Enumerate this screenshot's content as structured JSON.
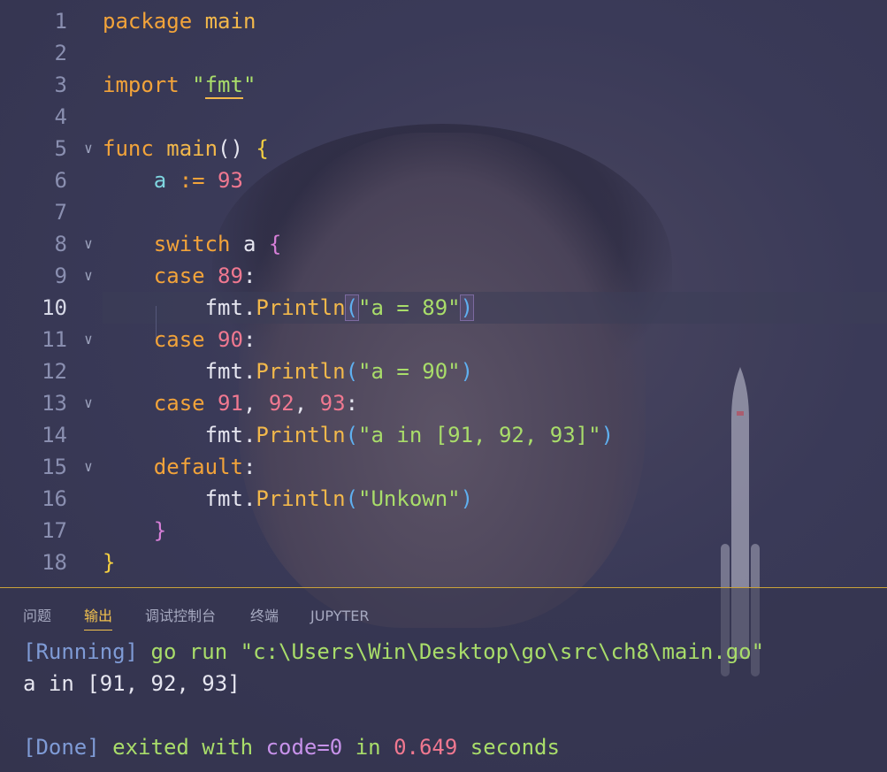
{
  "editor": {
    "active_line": "10",
    "lines": [
      {
        "n": "1",
        "tokens": [
          {
            "t": "package ",
            "c": "kw"
          },
          {
            "t": "main",
            "c": "fn"
          }
        ]
      },
      {
        "n": "2",
        "tokens": []
      },
      {
        "n": "3",
        "tokens": [
          {
            "t": "import ",
            "c": "kw"
          },
          {
            "t": "\"",
            "c": "str2"
          },
          {
            "t": "fmt",
            "c": "fmt"
          },
          {
            "t": "\"",
            "c": "str2"
          }
        ]
      },
      {
        "n": "4",
        "tokens": []
      },
      {
        "n": "5",
        "tokens": [
          {
            "t": "func ",
            "c": "kw"
          },
          {
            "t": "main",
            "c": "fn"
          },
          {
            "t": "() ",
            "c": "pun"
          },
          {
            "t": "{",
            "c": "br1"
          }
        ]
      },
      {
        "n": "6",
        "tokens": [
          {
            "t": "    "
          },
          {
            "t": "a",
            "c": "var"
          },
          {
            "t": " := ",
            "c": "kw"
          },
          {
            "t": "93",
            "c": "num"
          }
        ]
      },
      {
        "n": "7",
        "tokens": []
      },
      {
        "n": "8",
        "tokens": [
          {
            "t": "    "
          },
          {
            "t": "switch ",
            "c": "kw"
          },
          {
            "t": "a ",
            "c": "id"
          },
          {
            "t": "{",
            "c": "br2"
          }
        ]
      },
      {
        "n": "9",
        "tokens": [
          {
            "t": "    "
          },
          {
            "t": "case ",
            "c": "kw"
          },
          {
            "t": "89",
            "c": "num"
          },
          {
            "t": ":",
            "c": "pun"
          }
        ]
      },
      {
        "n": "10",
        "tokens": [
          {
            "t": "        "
          },
          {
            "t": "fmt",
            "c": "id"
          },
          {
            "t": ".",
            "c": "pun"
          },
          {
            "t": "Println",
            "c": "fn"
          },
          {
            "t": "(",
            "c": "br3hl"
          },
          {
            "t": "\"a = 89\"",
            "c": "str"
          },
          {
            "t": ")",
            "c": "br3hl"
          }
        ]
      },
      {
        "n": "11",
        "tokens": [
          {
            "t": "    "
          },
          {
            "t": "case ",
            "c": "kw"
          },
          {
            "t": "90",
            "c": "num"
          },
          {
            "t": ":",
            "c": "pun"
          }
        ]
      },
      {
        "n": "12",
        "tokens": [
          {
            "t": "        "
          },
          {
            "t": "fmt",
            "c": "id"
          },
          {
            "t": ".",
            "c": "pun"
          },
          {
            "t": "Println",
            "c": "fn"
          },
          {
            "t": "(",
            "c": "br3"
          },
          {
            "t": "\"a = 90\"",
            "c": "str"
          },
          {
            "t": ")",
            "c": "br3"
          }
        ]
      },
      {
        "n": "13",
        "tokens": [
          {
            "t": "    "
          },
          {
            "t": "case ",
            "c": "kw"
          },
          {
            "t": "91",
            "c": "num"
          },
          {
            "t": ", ",
            "c": "pun"
          },
          {
            "t": "92",
            "c": "num"
          },
          {
            "t": ", ",
            "c": "pun"
          },
          {
            "t": "93",
            "c": "num"
          },
          {
            "t": ":",
            "c": "pun"
          }
        ]
      },
      {
        "n": "14",
        "tokens": [
          {
            "t": "        "
          },
          {
            "t": "fmt",
            "c": "id"
          },
          {
            "t": ".",
            "c": "pun"
          },
          {
            "t": "Println",
            "c": "fn"
          },
          {
            "t": "(",
            "c": "br3"
          },
          {
            "t": "\"a in [91, 92, 93]\"",
            "c": "str"
          },
          {
            "t": ")",
            "c": "br3"
          }
        ]
      },
      {
        "n": "15",
        "tokens": [
          {
            "t": "    "
          },
          {
            "t": "default",
            "c": "kw"
          },
          {
            "t": ":",
            "c": "pun"
          }
        ]
      },
      {
        "n": "16",
        "tokens": [
          {
            "t": "        "
          },
          {
            "t": "fmt",
            "c": "id"
          },
          {
            "t": ".",
            "c": "pun"
          },
          {
            "t": "Println",
            "c": "fn"
          },
          {
            "t": "(",
            "c": "br3"
          },
          {
            "t": "\"Unkown\"",
            "c": "str"
          },
          {
            "t": ")",
            "c": "br3"
          }
        ]
      },
      {
        "n": "17",
        "tokens": [
          {
            "t": "    "
          },
          {
            "t": "}",
            "c": "br2"
          }
        ]
      },
      {
        "n": "18",
        "tokens": [
          {
            "t": "}",
            "c": "br1"
          }
        ]
      }
    ],
    "foldable_lines": [
      "5",
      "8",
      "9",
      "11",
      "13",
      "15"
    ]
  },
  "panel": {
    "tabs": [
      {
        "label": "问题",
        "active": false
      },
      {
        "label": "输出",
        "active": true
      },
      {
        "label": "调试控制台",
        "active": false
      },
      {
        "label": "终端",
        "active": false
      },
      {
        "label": "JUPYTER",
        "active": false
      }
    ],
    "output": {
      "running_tag": "[Running]",
      "running_cmd": "go run \"c:\\Users\\Win\\Desktop\\go\\src\\ch8\\main.go\"",
      "result": "a in [91, 92, 93]",
      "done_tag": "[Done]",
      "done_text1": "exited with",
      "done_code": "code=0",
      "done_text2": "in",
      "done_time": "0.649",
      "done_text3": "seconds"
    }
  },
  "colors": {
    "keyword": "#f2a33a",
    "string": "#a9dd6a",
    "number": "#f07890",
    "active_tab": "#f2c14e"
  }
}
